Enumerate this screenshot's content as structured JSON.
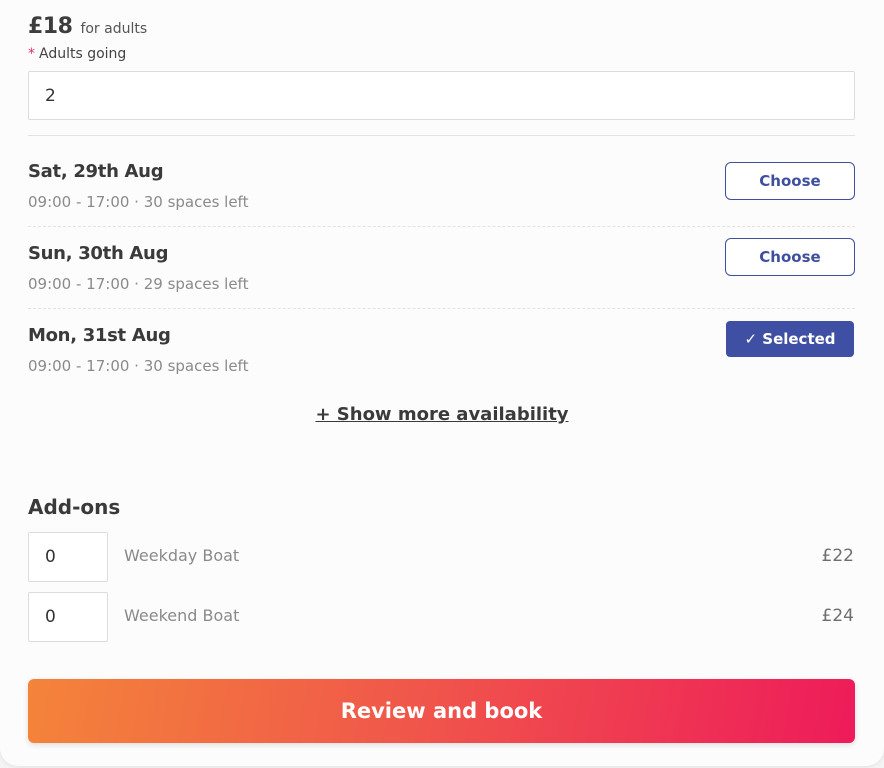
{
  "pricing": {
    "price": "£18",
    "price_suffix": "for adults"
  },
  "adults_field": {
    "required_marker": "*",
    "label": "Adults going",
    "value": "2"
  },
  "slots": [
    {
      "date": "Sat, 29th Aug",
      "info": "09:00 - 17:00 · 30 spaces left",
      "button_label": "Choose",
      "selected": false
    },
    {
      "date": "Sun, 30th Aug",
      "info": "09:00 - 17:00 · 29 spaces left",
      "button_label": "Choose",
      "selected": false
    },
    {
      "date": "Mon, 31st Aug",
      "info": "09:00 - 17:00 · 30 spaces left",
      "button_label": "✓ Selected",
      "selected": true
    }
  ],
  "show_more_label": "+ Show more availability",
  "addons": {
    "title": "Add-ons",
    "items": [
      {
        "quantity": "0",
        "name": "Weekday Boat",
        "price": "£22"
      },
      {
        "quantity": "0",
        "name": "Weekend Boat",
        "price": "£24"
      }
    ]
  },
  "book_button_label": "Review and book",
  "colors": {
    "accent_blue": "#3f4fa3",
    "required_pink": "#e0306a",
    "gradient_start": "#f4843a",
    "gradient_end": "#ee1b5a"
  }
}
